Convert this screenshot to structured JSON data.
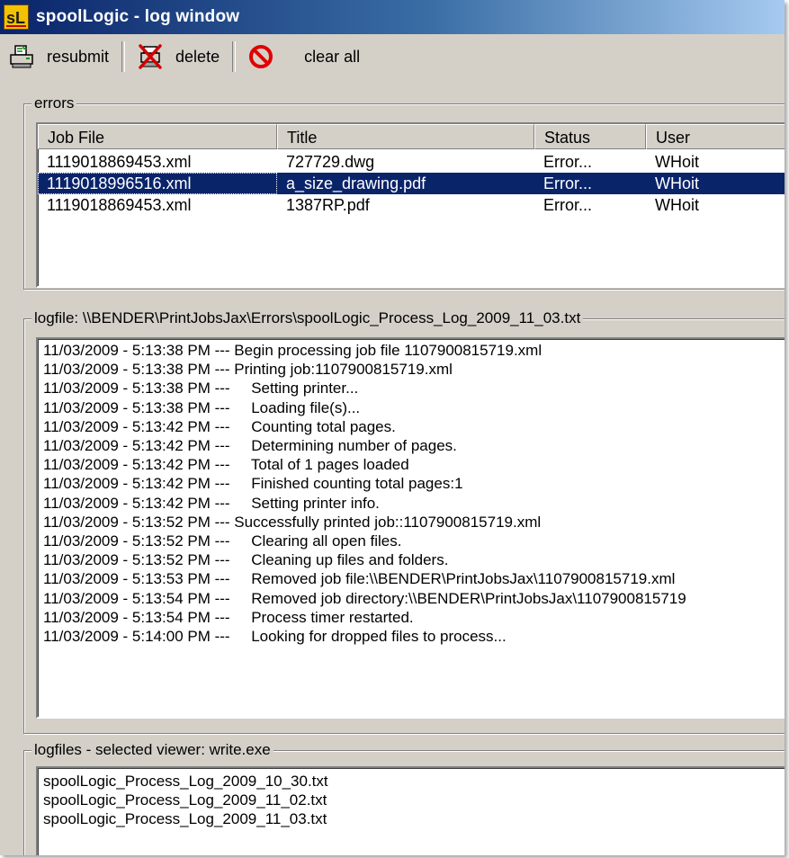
{
  "window": {
    "title": "spoolLogic - log window"
  },
  "toolbar": {
    "resubmit_label": "resubmit",
    "delete_label": "delete",
    "clear_all_label": "clear all"
  },
  "errors": {
    "label": "errors",
    "columns": [
      "Job File",
      "Title",
      "Status",
      "User"
    ],
    "rows": [
      {
        "job_file": "1119018869453.xml",
        "title": "727729.dwg",
        "status": "Error...",
        "user": "WHoit",
        "selected": false
      },
      {
        "job_file": "1119018996516.xml",
        "title": "a_size_drawing.pdf",
        "status": "Error...",
        "user": "WHoit",
        "selected": true
      },
      {
        "job_file": "1119018869453.xml",
        "title": "1387RP.pdf",
        "status": "Error...",
        "user": "WHoit",
        "selected": false
      }
    ]
  },
  "logfile": {
    "label": "logfile: \\\\BENDER\\PrintJobsJax\\Errors\\spoolLogic_Process_Log_2009_11_03.txt",
    "lines": [
      "11/03/2009 - 5:13:38 PM --- Begin processing job file 1107900815719.xml",
      "11/03/2009 - 5:13:38 PM --- Printing job:1107900815719.xml",
      "11/03/2009 - 5:13:38 PM ---     Setting printer...",
      "11/03/2009 - 5:13:38 PM ---     Loading file(s)...",
      "11/03/2009 - 5:13:42 PM ---     Counting total pages.",
      "11/03/2009 - 5:13:42 PM ---     Determining number of pages.",
      "11/03/2009 - 5:13:42 PM ---     Total of 1 pages loaded",
      "11/03/2009 - 5:13:42 PM ---     Finished counting total pages:1",
      "11/03/2009 - 5:13:42 PM ---     Setting printer info.",
      "11/03/2009 - 5:13:52 PM --- Successfully printed job::1107900815719.xml",
      "11/03/2009 - 5:13:52 PM ---     Clearing all open files.",
      "11/03/2009 - 5:13:52 PM ---     Cleaning up files and folders.",
      "11/03/2009 - 5:13:53 PM ---     Removed job file:\\\\BENDER\\PrintJobsJax\\1107900815719.xml",
      "11/03/2009 - 5:13:54 PM ---     Removed job directory:\\\\BENDER\\PrintJobsJax\\1107900815719",
      "11/03/2009 - 5:13:54 PM ---     Process timer restarted.",
      "11/03/2009 - 5:14:00 PM ---     Looking for dropped files to process..."
    ]
  },
  "logfiles": {
    "label": "logfiles - selected viewer: write.exe",
    "items": [
      "spoolLogic_Process_Log_2009_10_30.txt",
      "spoolLogic_Process_Log_2009_11_02.txt",
      "spoolLogic_Process_Log_2009_11_03.txt"
    ]
  }
}
